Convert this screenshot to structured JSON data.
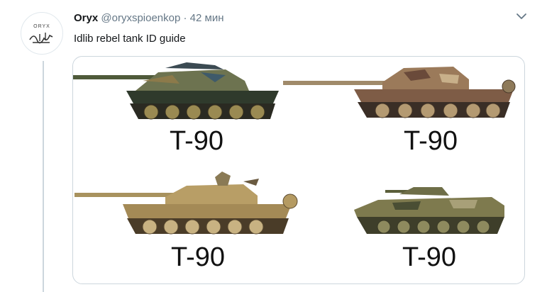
{
  "tweet": {
    "author_name": "Oryx",
    "handle": "@oryxspioenkop",
    "separator": "·",
    "time": "42 мин",
    "text": "Idlib rebel tank ID guide",
    "avatar_brand": "ORYX",
    "caret_icon": "chevron-down-icon"
  },
  "media": {
    "labels": [
      "T-90",
      "T-90",
      "T-90",
      "T-90"
    ]
  },
  "colors": {
    "name": "#14171a",
    "meta": "#657786",
    "border": "#ccd6dd"
  }
}
